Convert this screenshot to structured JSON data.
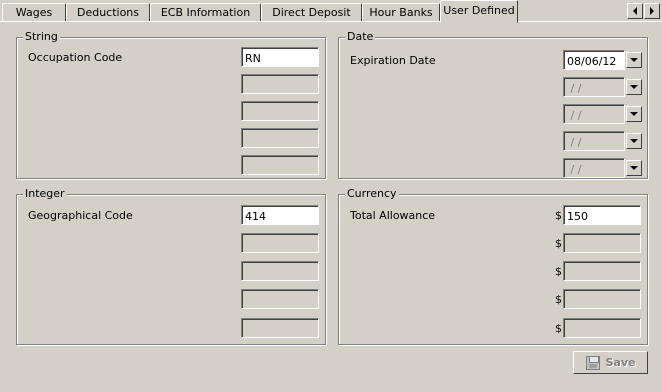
{
  "tabs": [
    {
      "label": "Wages",
      "active": false
    },
    {
      "label": "Deductions",
      "active": false
    },
    {
      "label": "ECB Information",
      "active": false
    },
    {
      "label": "Direct Deposit",
      "active": false
    },
    {
      "label": "Hour Banks",
      "active": false
    },
    {
      "label": "User Defined",
      "active": true
    }
  ],
  "string_group": {
    "title": "String",
    "label": "Occupation Code",
    "values": [
      "RN",
      "",
      "",
      "",
      ""
    ]
  },
  "date_group": {
    "title": "Date",
    "label": "Expiration Date",
    "values": [
      "08/06/12",
      " / /",
      " / /",
      " / /",
      " / /"
    ]
  },
  "integer_group": {
    "title": "Integer",
    "label": "Geographical Code",
    "values": [
      "414",
      "",
      "",
      "",
      ""
    ]
  },
  "currency_group": {
    "title": "Currency",
    "label": "Total Allowance",
    "symbol": "$",
    "values": [
      "150",
      "",
      "",
      "",
      ""
    ]
  },
  "save_button": {
    "label": "Save",
    "enabled": false
  }
}
